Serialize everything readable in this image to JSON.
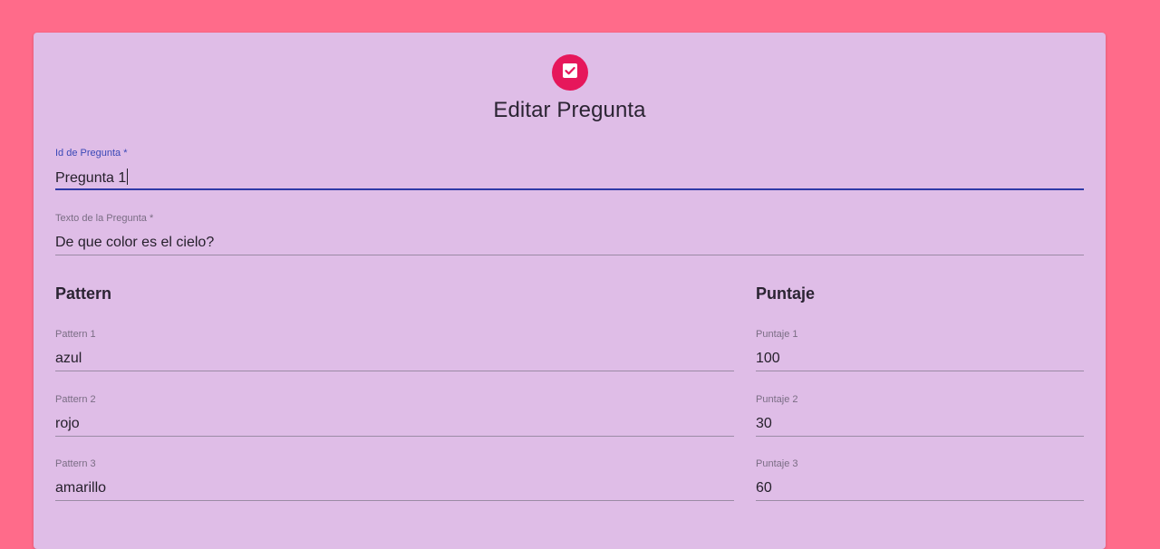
{
  "header": {
    "title": "Editar Pregunta",
    "icon": "check-box-icon",
    "accent_color": "#e6175b"
  },
  "form": {
    "id_field": {
      "label": "Id de Pregunta *",
      "value": "Pregunta 1"
    },
    "text_field": {
      "label": "Texto de la Pregunta *",
      "value": "De que color es el cielo?"
    }
  },
  "patterns": {
    "heading": "Pattern",
    "items": [
      {
        "label": "Pattern 1",
        "value": "azul"
      },
      {
        "label": "Pattern 2",
        "value": "rojo"
      },
      {
        "label": "Pattern 3",
        "value": "amarillo"
      }
    ]
  },
  "scores": {
    "heading": "Puntaje",
    "items": [
      {
        "label": "Puntaje 1",
        "value": "100"
      },
      {
        "label": "Puntaje 2",
        "value": "30"
      },
      {
        "label": "Puntaje 3",
        "value": "60"
      }
    ]
  },
  "colors": {
    "page_background": "#ff6b8a",
    "card_background": "#dfbde7",
    "focus_color": "#2f3aa6"
  }
}
